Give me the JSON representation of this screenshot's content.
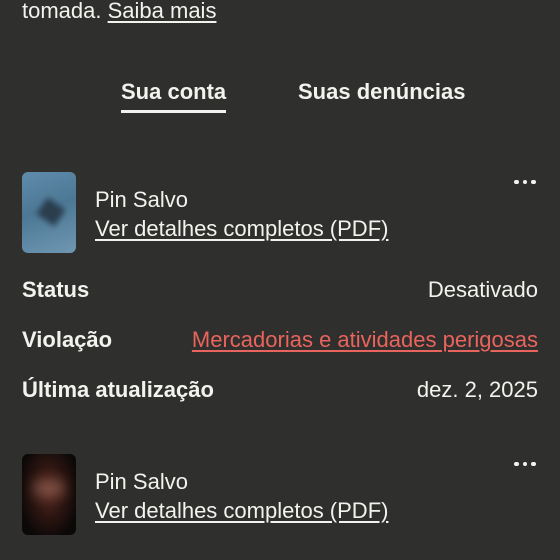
{
  "intro": {
    "text": "tomada. ",
    "link_label": "Saiba mais"
  },
  "tabs": [
    {
      "label": "Sua conta",
      "active": true
    },
    {
      "label": "Suas denúncias",
      "active": false
    }
  ],
  "reports": [
    {
      "pin_title": "Pin Salvo",
      "details_link": "Ver detalhes completos (PDF)",
      "thumbnail": "blurred-blue-image",
      "rows": [
        {
          "label": "Status",
          "value": "Desativado"
        },
        {
          "label": "Violação",
          "value": "Mercadorias e atividades perigosas"
        },
        {
          "label": "Última atualização",
          "value": "dez. 2, 2025"
        }
      ]
    },
    {
      "pin_title": "Pin Salvo",
      "details_link": "Ver detalhes completos (PDF)",
      "thumbnail": "blurred-dark-image"
    }
  ],
  "icons": {
    "more": "more-options-icon"
  },
  "colors": {
    "background": "#2f2f2d",
    "text": "#f2f2ee",
    "violation_link": "#e8645c"
  }
}
